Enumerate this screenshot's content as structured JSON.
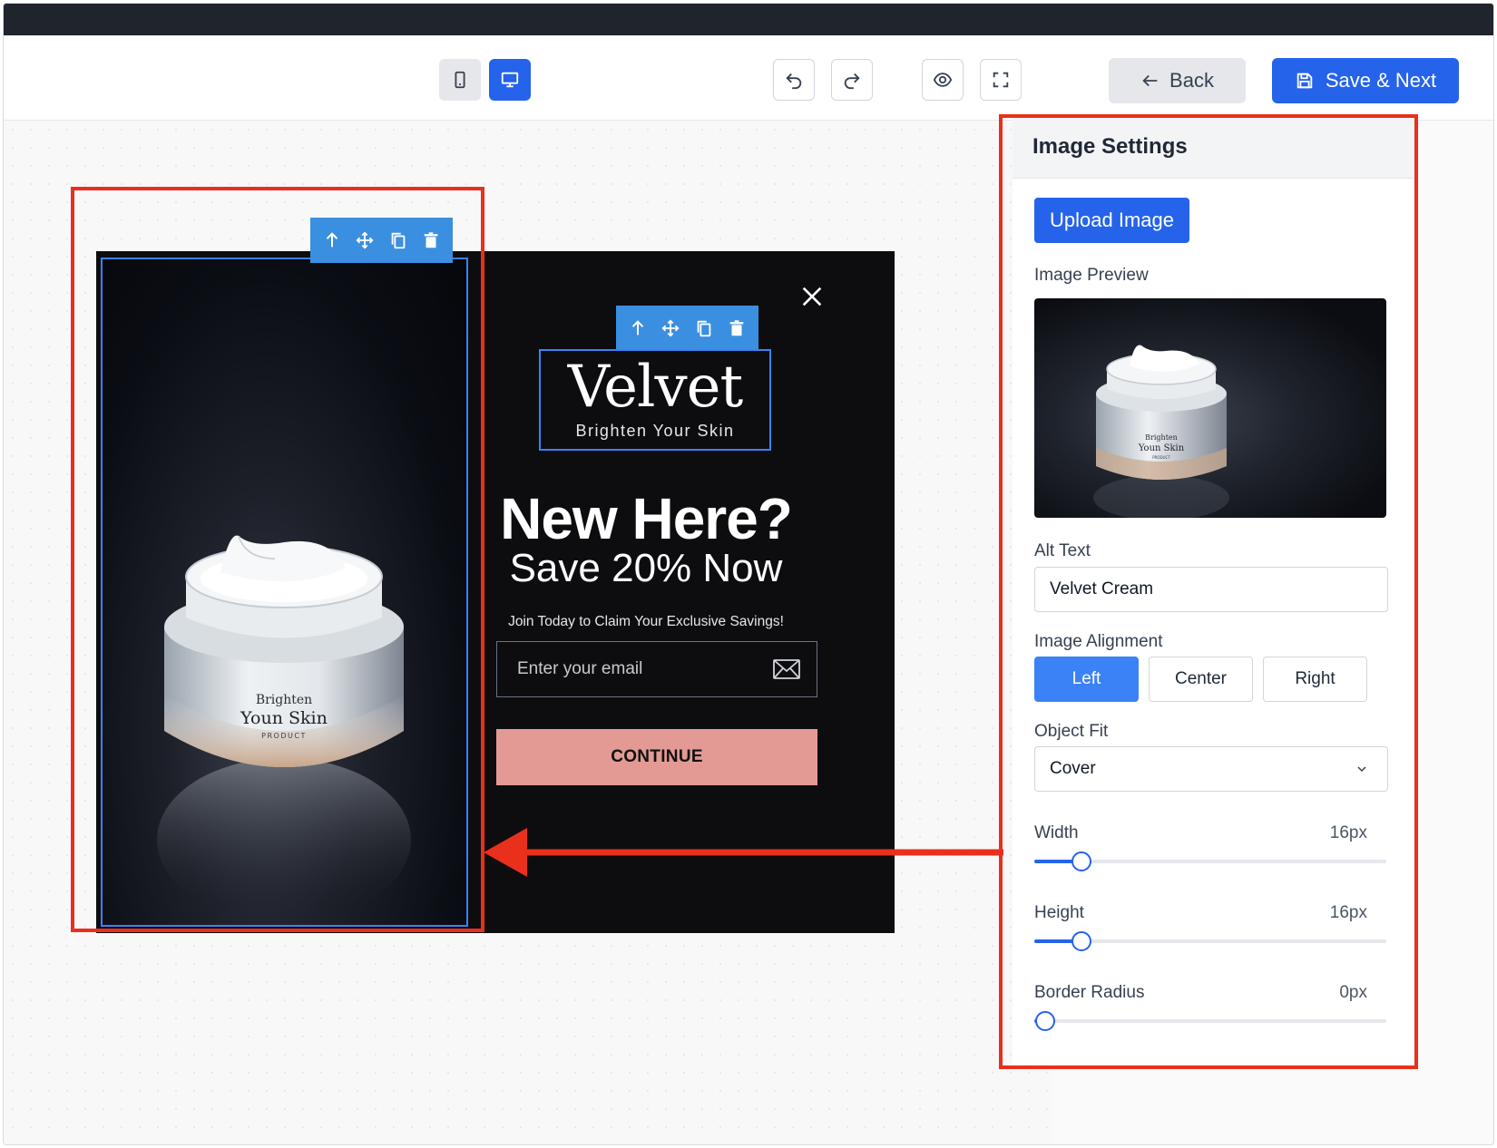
{
  "toolbar": {
    "back_label": "Back",
    "save_label": "Save & Next",
    "icons": [
      "mobile-icon",
      "desktop-icon",
      "undo-icon",
      "redo-icon",
      "eye-icon",
      "fullscreen-icon"
    ]
  },
  "popup": {
    "logo_name": "Velvet",
    "logo_tagline": "Brighten Your Skin",
    "headline": "New Here?",
    "subheadline": "Save 20% Now",
    "description": "Join Today to Claim Your Exclusive Savings!",
    "email_placeholder": "Enter your email",
    "continue_label": "CONTINUE",
    "jar_label_line1": "Brighten",
    "jar_label_line2": "Youn Skin",
    "jar_label_line3": "PRODUCT"
  },
  "panel": {
    "title": "Image Settings",
    "upload_label": "Upload Image",
    "preview_label": "Image Preview",
    "alt_text_label": "Alt Text",
    "alt_text_value": "Velvet Cream",
    "alignment_label": "Image Alignment",
    "alignment_options": [
      "Left",
      "Center",
      "Right"
    ],
    "alignment_selected": "Left",
    "object_fit_label": "Object Fit",
    "object_fit_value": "Cover",
    "width": {
      "label": "Width",
      "value_text": "16px",
      "fraction": 0.135
    },
    "height": {
      "label": "Height",
      "value_text": "16px",
      "fraction": 0.135
    },
    "border_radius": {
      "label": "Border Radius",
      "value_text": "0px",
      "fraction": 0.03
    }
  },
  "colors": {
    "accent": "#2563eb",
    "annotation": "#e8301d",
    "continue_button": "#e49a94",
    "popup_background": "#0d0d10"
  }
}
